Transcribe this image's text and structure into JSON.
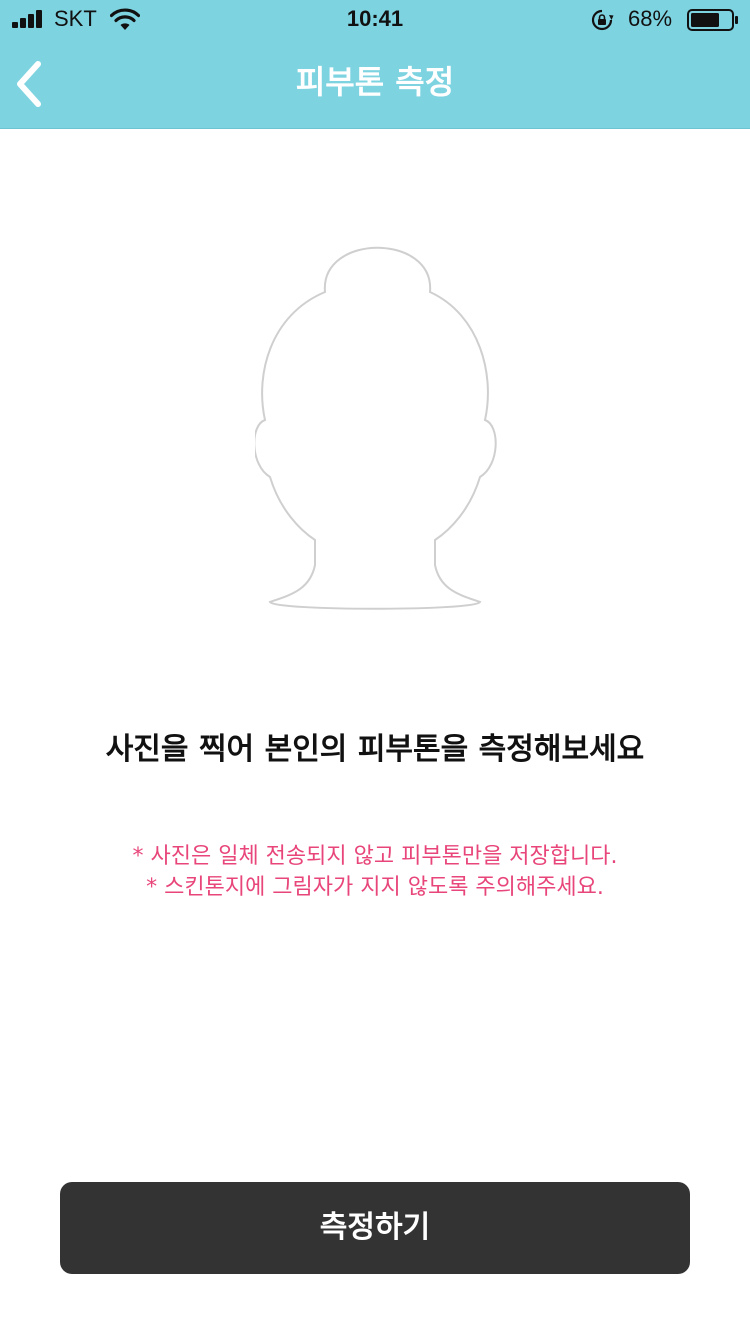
{
  "status_bar": {
    "carrier": "SKT",
    "time": "10:41",
    "battery_percent": "68%",
    "battery_level": 0.68
  },
  "header": {
    "title": "피부톤 측정",
    "background_color": "#7ed3e1",
    "back_icon": "chevron-left-icon"
  },
  "main": {
    "illustration": "face-silhouette",
    "heading": "사진을 찍어 본인의 피부톤을 측정해보세요",
    "notices": [
      "* 사진은 일체 전송되지 않고 피부톤만을 저장합니다.",
      "* 스킨톤지에 그림자가 지지 않도록 주의해주세요."
    ],
    "notice_color": "#e8467a"
  },
  "footer": {
    "button_label": "측정하기",
    "button_color": "#333333"
  }
}
